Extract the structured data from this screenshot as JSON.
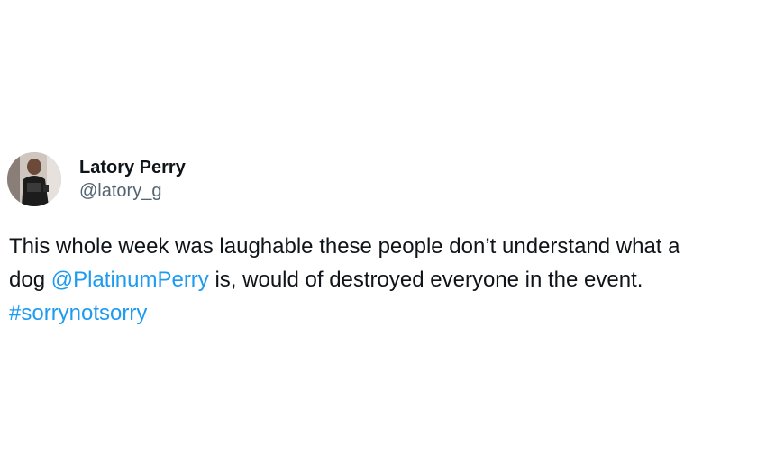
{
  "tweet": {
    "display_name": "Latory Perry",
    "handle": "@latory_g",
    "text_line1": "This whole week was laughable these people don’t understand what a",
    "text_dog": "dog ",
    "mention": "@PlatinumPerry",
    "text_after_mention": " is, would of destroyed everyone in the event.",
    "hashtag": "#sorrynotsorry"
  },
  "colors": {
    "link": "#1d9bf0",
    "handle": "#536471",
    "text": "#0f1419"
  }
}
